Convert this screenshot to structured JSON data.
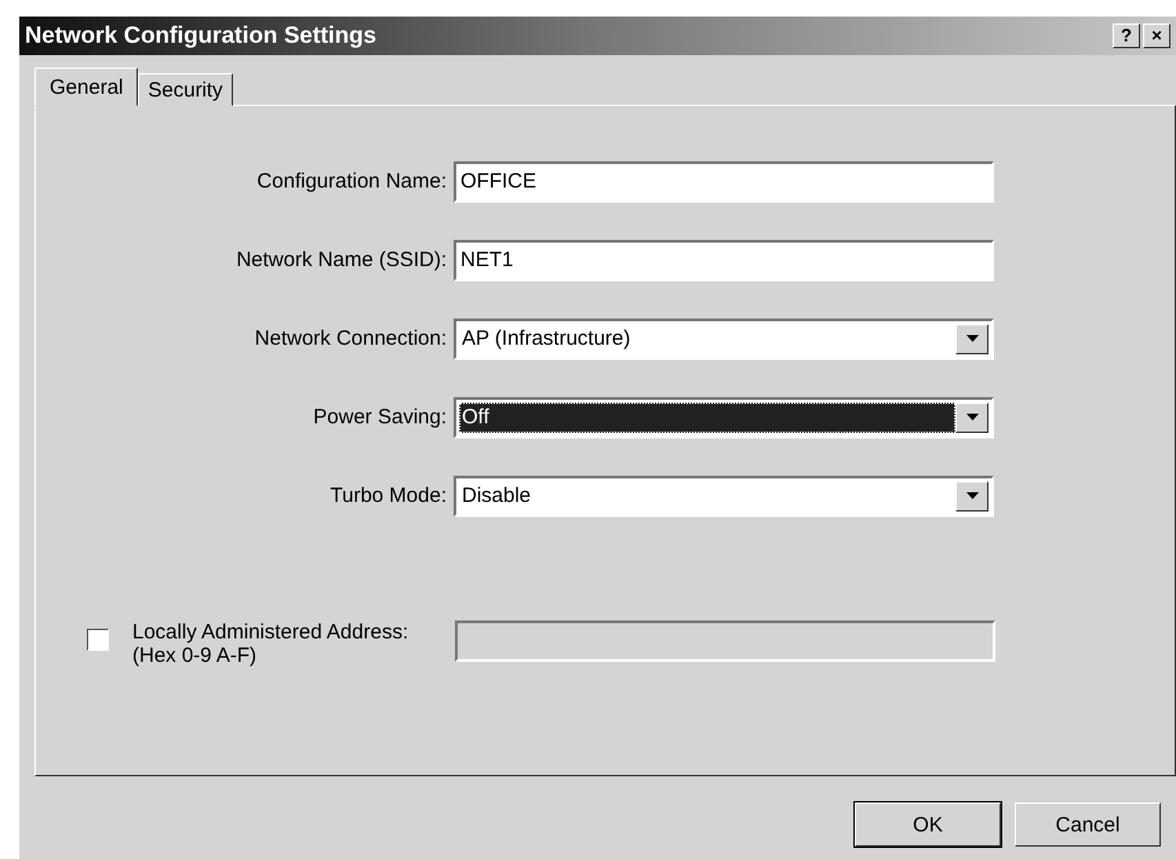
{
  "window": {
    "title": "Network Configuration Settings",
    "title_buttons": [
      "?",
      "×"
    ]
  },
  "tabs": [
    {
      "label": "General",
      "selected": true
    },
    {
      "label": "Security",
      "selected": false
    }
  ],
  "fields": [
    {
      "kind": "text",
      "label": "Configuration Name:",
      "value": "OFFICE"
    },
    {
      "kind": "text",
      "label": "Network Name (SSID):",
      "value": "NET1"
    },
    {
      "kind": "select",
      "label": "Network Connection:",
      "value": "AP (Infrastructure)",
      "focused": false
    },
    {
      "kind": "select",
      "label": "Power Saving:",
      "value": "Off",
      "focused": true
    },
    {
      "kind": "select",
      "label": "Turbo Mode:",
      "value": "Disable",
      "focused": false
    }
  ],
  "address": {
    "checked": false,
    "label": "Locally Administered Address:",
    "hint": "(Hex 0-9 A-F)",
    "disabled": true
  },
  "buttons": [
    "OK",
    "Cancel"
  ]
}
